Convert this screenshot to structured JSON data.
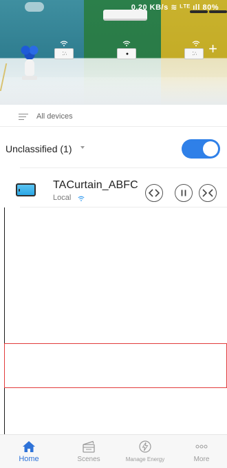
{
  "status_bar": {
    "right_text": "0.20 KB/s  ≋ ᴸᵀᴱ ıll 80%"
  },
  "banner": {
    "plus_symbol": "+"
  },
  "filter": {
    "label": "All devices"
  },
  "group": {
    "label": "Unclassified (1)",
    "toggle_on": true
  },
  "devices": [
    {
      "name": "TACurtain_ABFC",
      "status": "Local"
    }
  ],
  "bottom_nav": {
    "items": [
      {
        "label": "Home",
        "icon": "home-icon",
        "active": true
      },
      {
        "label": "Scenes",
        "icon": "scenes-icon",
        "active": false
      },
      {
        "label": "Manage Energy",
        "icon": "energy-icon",
        "active": false
      },
      {
        "label": "More",
        "icon": "more-icon",
        "active": false
      }
    ]
  },
  "colors": {
    "accent": "#2f80e8",
    "active_nav": "#2f73d8",
    "highlight_border": "#e23b3b"
  }
}
